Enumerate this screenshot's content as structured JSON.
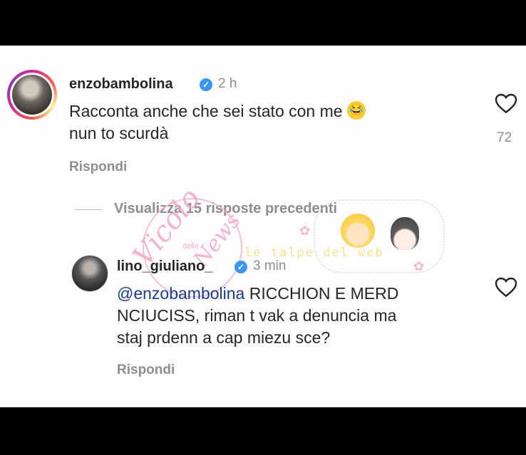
{
  "comment1": {
    "username": "enzobambolina",
    "time": "2 h",
    "text_line1": "Racconta anche che sei stato con me",
    "emoji": "😂",
    "text_line2": "nun to scurdà",
    "reply_label": "Rispondi",
    "likes": "72"
  },
  "view_replies": "Visualizza 15 risposte precedenti",
  "comment2": {
    "username": "lino_giuliano_",
    "time": "3 min",
    "mention": "@enzobambolina",
    "text_line1_rest": " RICCHION E MERD",
    "text_line2": "NCIUCISS, riman t vak a denuncia ma",
    "text_line3": "staj prdenn a cap miezu sce?",
    "reply_label": "Rispondi"
  },
  "watermark": {
    "script_top": "Vicolo",
    "script_bottom": "News",
    "small": "delle",
    "banner": "le talpe del web"
  },
  "colors": {
    "verified": "#3897f0",
    "mention": "#1a3d8f",
    "muted": "#8e8e8e",
    "text": "#262626"
  }
}
